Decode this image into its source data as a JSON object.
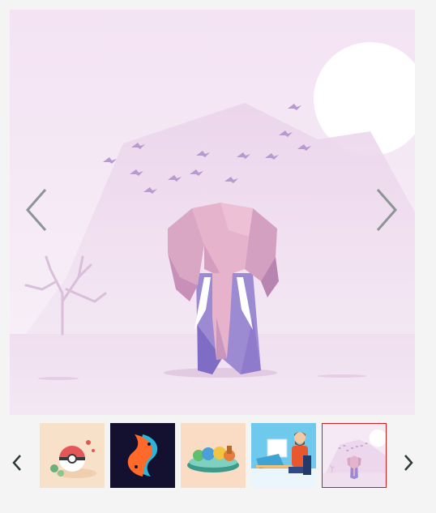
{
  "viewer": {
    "current_image": "elephant-lowpoly",
    "main_prev_icon": "chevron-left-icon",
    "main_next_icon": "chevron-right-icon"
  },
  "thumbnails": {
    "prev_icon": "chevron-left-icon",
    "next_icon": "chevron-right-icon",
    "selected_index": 4,
    "items": [
      {
        "subject": "pokeball"
      },
      {
        "subject": "fish-yin-yang"
      },
      {
        "subject": "monsters-on-island"
      },
      {
        "subject": "man-at-computer"
      },
      {
        "subject": "elephant-lowpoly"
      }
    ]
  },
  "colors": {
    "accent_selected": "#d11a1a",
    "arrow_gray": "#8c9596",
    "thumb_nav": "#2e3a3a",
    "sky_pink": "#f5e9f5",
    "bird_purple": "#b79ad0"
  }
}
